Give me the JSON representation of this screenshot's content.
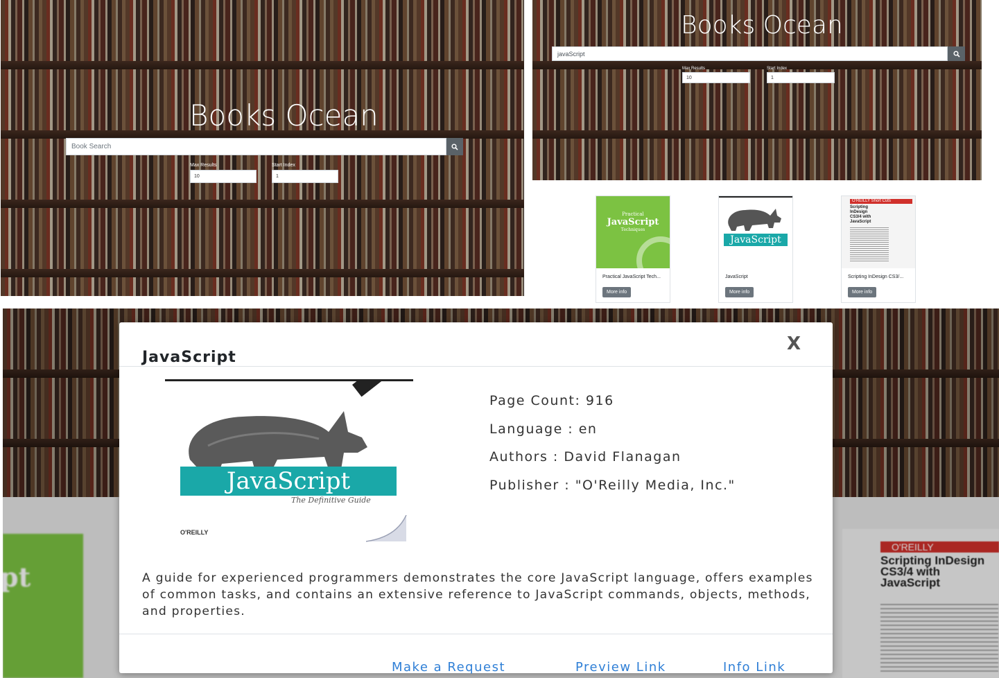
{
  "home": {
    "title": "Books Ocean",
    "search_placeholder": "Book Search",
    "max_results_label": "Max Results",
    "max_results_value": "10",
    "start_index_label": "Start Index",
    "start_index_value": "1"
  },
  "results": {
    "title": "Books Ocean",
    "search_value": "javaScript",
    "max_results_label": "Max Results",
    "max_results_value": "10",
    "start_index_label": "Start Index",
    "start_index_value": "1",
    "more_info_label": "More info",
    "books": [
      {
        "title": "Practical JavaScript Tech...",
        "cover_text": "JavaScript",
        "cover_subtitle": "Techniques",
        "cover_pre": "Practical"
      },
      {
        "title": "JavaScript",
        "cover_text": "JavaScript"
      },
      {
        "title": "Scripting InDesign CS3/...",
        "cover_brand": "O'REILLY",
        "cover_series": "Short Cuts",
        "cover_text": "Scripting InDesign CS3/4 with JavaScript"
      }
    ]
  },
  "modal": {
    "title": "JavaScript",
    "close_label": "X",
    "page_count": "Page Count: 916",
    "language": "Language : en",
    "authors": "Authors : David Flanagan",
    "publisher": "Publisher : \"O'Reilly Media, Inc.\"",
    "description": "A guide for experienced programmers demonstrates the core JavaScript language, offers examples of common tasks, and contains an extensive reference to JavaScript commands, objects, methods, and properties.",
    "cover_title": "JavaScript",
    "cover_subtitle": "The Definitive Guide",
    "cover_publisher": "O'REILLY",
    "links": {
      "request": "Make a Request",
      "preview": "Preview Link",
      "info": "Info Link"
    },
    "backdrop_left_text": "pt",
    "backdrop_right_brand": "O'REILLY",
    "backdrop_right_title": "Scripting InDesign CS3/4 with JavaScript"
  },
  "colors": {
    "accent_link": "#2f7fd6",
    "button_gray": "#6c757d",
    "search_button": "#5a6268",
    "js_teal": "#1aa8a8",
    "cover_green": "#7cc242",
    "oreilly_red": "#d0302b"
  },
  "icons": {
    "search": "search-icon",
    "close": "close-icon",
    "rhino": "rhino-illustration"
  }
}
